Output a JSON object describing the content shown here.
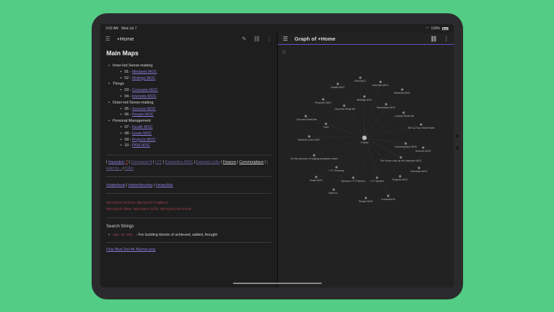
{
  "status": {
    "time": "3:02 AM",
    "date": "Wed Jul 7",
    "battery": "100%"
  },
  "left": {
    "title": "+Home",
    "heading": "Main Maps",
    "groups": [
      {
        "label": "Inner-led Sense-making",
        "items": [
          {
            "num": "01 - ",
            "link": "Mindsets MOC"
          },
          {
            "num": "02 - ",
            "link": "Writings MOC"
          }
        ]
      },
      {
        "label": "Things",
        "items": [
          {
            "num": "03 - ",
            "link": "Concepts MOC"
          },
          {
            "num": "04 - ",
            "link": "Interests MOC"
          }
        ]
      },
      {
        "label": "Outer-led Sense-making",
        "items": [
          {
            "num": "05 - ",
            "link": "Sources MOC"
          },
          {
            "num": "06 - ",
            "link": "People MOC"
          }
        ]
      },
      {
        "label": "Personal Management",
        "items": [
          {
            "num": "07 - ",
            "link": "Health MOC"
          },
          {
            "num": "08 - ",
            "link": "Goals MOC"
          },
          {
            "num": "09 - ",
            "link": "Projects MOC"
          },
          {
            "num": "10 - ",
            "link": "PKM MOC"
          }
        ]
      }
    ],
    "quick_links": {
      "question": "#question",
      "question_count": "7",
      "command": "Command N",
      "lyt": "LYT",
      "reminders": "Reminders MOC",
      "external": "External Links",
      "finance": "Finance",
      "commonplace": "Commonplace",
      "iwantto": "I want to...",
      "todo": "ToDo"
    },
    "state_tags": [
      "#state/boat",
      "#state/develop",
      "#state/tidy"
    ],
    "project_tags": [
      "#project/active",
      "#project/rowburn",
      "#project/idea",
      "#project/idle",
      "#project/archive"
    ],
    "search_heading": "Search Strings",
    "search_code": "#px ## ###",
    "search_desc": " - For building blocks of achieved, added, thought",
    "banner_link": "Pale Blue Dot 4K Banner.png"
  },
  "right": {
    "title": "Graph of +Home",
    "nodes": [
      {
        "label": "PKM MOC"
      },
      {
        "label": "Health MOC"
      },
      {
        "label": "Interests MOC"
      },
      {
        "label": "Mindsets MOC"
      },
      {
        "label": "Finances MOC"
      },
      {
        "label": "Writings MOC"
      },
      {
        "label": "...Sources Read Me"
      },
      {
        "label": "Reminders MOC"
      },
      {
        "label": "...Lesson Read Me"
      },
      {
        "label": "...Sources Read Me"
      },
      {
        "label": "ToDo"
      },
      {
        "label": "Set Up Your Home Note"
      },
      {
        "label": "External Links MOC"
      },
      {
        "label": "+Home"
      },
      {
        "label": "Commonplace MOC"
      },
      {
        "label": "Sources MOC"
      },
      {
        "label": "On the process of forging evergreen notes"
      },
      {
        "label": "The Home note as the Interests MOC"
      },
      {
        "label": "LYT Glossary"
      },
      {
        "label": "Concepts MOC"
      },
      {
        "label": "Goals MOC"
      },
      {
        "label": "Sponsor LYT Patreon"
      },
      {
        "label": "LYT System"
      },
      {
        "label": "Projects MOC"
      },
      {
        "label": "I want to..."
      },
      {
        "label": "People MOC"
      },
      {
        "label": "Command N"
      }
    ]
  }
}
